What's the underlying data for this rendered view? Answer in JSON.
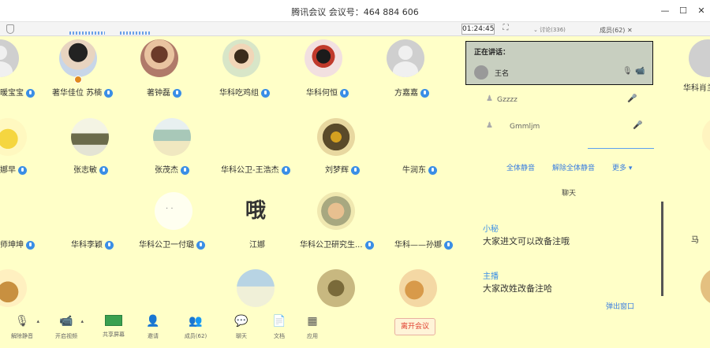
{
  "window": {
    "title": "腾讯会议 会议号：464 884 606",
    "minimize": "—",
    "maximize": "☐",
    "close": "✕"
  },
  "header": {
    "timer": "01:24:45",
    "fullscreen_icon": "expand-icon",
    "top_right_left": "⌄ 讨论(336)",
    "top_right_right": "成员(62) ✕"
  },
  "participants": [
    {
      "name": "暖宝宝",
      "avatar": "gray"
    },
    {
      "name": "著华佳位 苏楠",
      "avatar": "img1"
    },
    {
      "name": "著钟磊",
      "avatar": "img2"
    },
    {
      "name": "华科吃鸡组",
      "avatar": "img3"
    },
    {
      "name": "华科何恒",
      "avatar": "img4"
    },
    {
      "name": "方嘉嘉",
      "avatar": "gray"
    },
    {
      "name": "娜早",
      "avatar": "img5"
    },
    {
      "name": "张志敏",
      "avatar": "img6"
    },
    {
      "name": "张茂杰",
      "avatar": "img7"
    },
    {
      "name": "华科公卫-王浩杰",
      "avatar": "gray-none"
    },
    {
      "name": "刘梦辉",
      "avatar": "img8"
    },
    {
      "name": "牛润东",
      "avatar": "gray-none"
    },
    {
      "name": "师坤坤",
      "avatar": "img15"
    },
    {
      "name": "华科李颖",
      "avatar": "gray-none"
    },
    {
      "name": "华科公卫一付璐",
      "avatar": "img9"
    },
    {
      "name": "江娜",
      "avatar": "img10",
      "glyph": "哦"
    },
    {
      "name": "华科公卫研究生...",
      "avatar": "img11"
    },
    {
      "name": "华科——孙娜",
      "avatar": "gray-none"
    }
  ],
  "panel": {
    "speaking_title": "正在讲话：",
    "speaker_name": "王名",
    "rows": [
      {
        "name": "Gzzzz"
      },
      {
        "name": "Gmmljm"
      }
    ],
    "actions": {
      "mute_all": "全体静音",
      "unmute_all": "解除全体静音",
      "more": "更多 ▾"
    },
    "chat_title": "聊天",
    "messages": [
      {
        "sender": "小秘",
        "text": "大家进文可以改备注哦"
      },
      {
        "sender": "主播",
        "text": "大家改姓改备注哈"
      }
    ],
    "more_link": "弹出窗口"
  },
  "far_right": {
    "name1": "华科肖兰",
    "name2": "马"
  },
  "toolbar": {
    "items": [
      {
        "label": "解除静音",
        "icon": "mic-off-icon"
      },
      {
        "label": "开启视频",
        "icon": "camera-icon"
      },
      {
        "label": "共享屏幕",
        "icon": "share-screen-icon"
      },
      {
        "label": "邀请",
        "icon": "invite-icon"
      },
      {
        "label": "成员(62)",
        "icon": "members-icon"
      },
      {
        "label": "聊天",
        "icon": "chat-icon"
      },
      {
        "label": "文档",
        "icon": "document-icon"
      },
      {
        "label": "应用",
        "icon": "apps-icon"
      }
    ],
    "end_meeting": "离开会议"
  }
}
